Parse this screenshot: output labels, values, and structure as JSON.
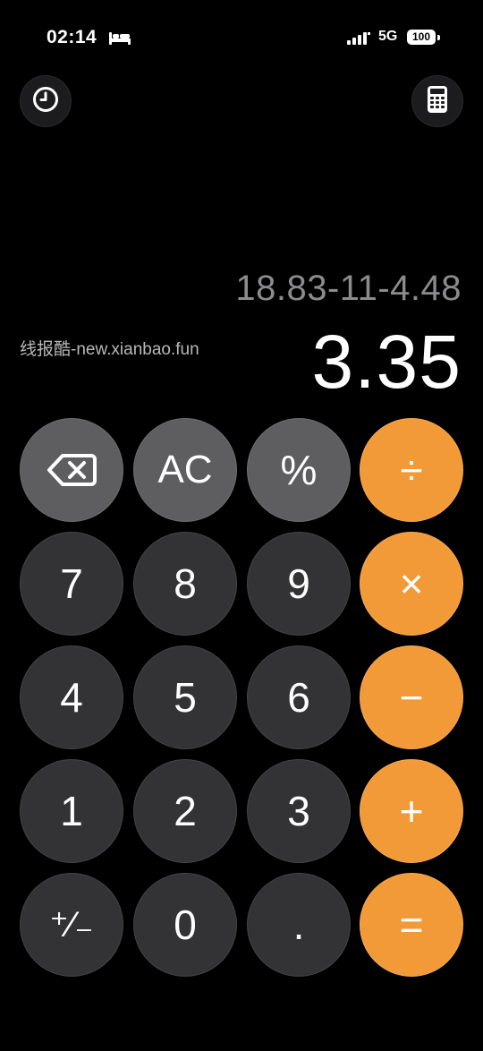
{
  "status": {
    "time": "02:14",
    "network": "5G",
    "battery": "100"
  },
  "display": {
    "expression": "18.83-11-4.48",
    "result": "3.35"
  },
  "watermark": "线报酷-new.xianbao.fun",
  "keys": {
    "backspace": "",
    "ac": "AC",
    "percent": "%",
    "divide": "÷",
    "seven": "7",
    "eight": "8",
    "nine": "9",
    "multiply": "×",
    "four": "4",
    "five": "5",
    "six": "6",
    "minus": "−",
    "one": "1",
    "two": "2",
    "three": "3",
    "plus": "+",
    "plusminus": "⁺∕₋",
    "zero": "0",
    "dot": ".",
    "equals": "="
  },
  "icons": {
    "history": "clock-icon",
    "calculator": "calculator-icon",
    "sleep": "bed-icon",
    "signal": "signal-icon",
    "backspace": "backspace-icon"
  },
  "colors": {
    "operator": "#f29a38",
    "function": "#5e5e60",
    "number": "#333335",
    "background": "#000000"
  }
}
